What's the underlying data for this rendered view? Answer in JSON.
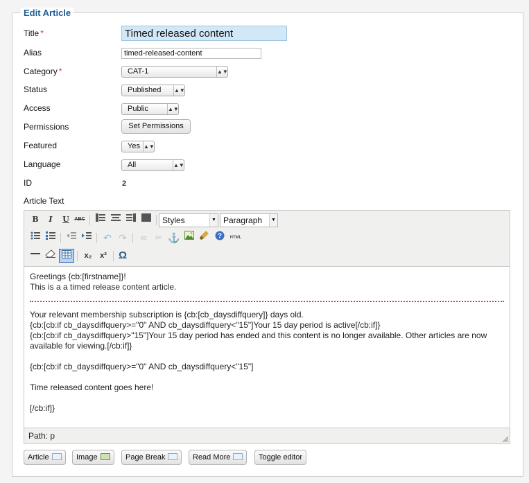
{
  "legend": "Edit Article",
  "fields": {
    "title": {
      "label": "Title",
      "required_mark": "*",
      "value": "Timed released content"
    },
    "alias": {
      "label": "Alias",
      "value": "timed-released-content"
    },
    "category": {
      "label": "Category",
      "required_mark": "*",
      "value": "CAT-1"
    },
    "status": {
      "label": "Status",
      "value": "Published"
    },
    "access": {
      "label": "Access",
      "value": "Public"
    },
    "permissions": {
      "label": "Permissions",
      "button": "Set Permissions"
    },
    "featured": {
      "label": "Featured",
      "value": "Yes"
    },
    "language": {
      "label": "Language",
      "value": "All"
    },
    "id": {
      "label": "ID",
      "value": "2"
    },
    "article_text": {
      "label": "Article Text"
    }
  },
  "toolbar": {
    "row1": {
      "bold": "B",
      "italic": "I",
      "underline": "U",
      "strike": "ABC",
      "styles": "Styles",
      "format": "Paragraph"
    },
    "html_label": "HTML",
    "subscript": "x₂",
    "superscript": "x²",
    "special_char": "Ω"
  },
  "content": {
    "line1": "Greetings {cb:[firstname]}!",
    "line2": "This is a a timed release content article.",
    "line3": "Your relevant membership subscription is {cb:[cb_daysdiffquery]} days old.",
    "line4": "{cb:[cb:if cb_daysdiffquery>=\"0\" AND cb_daysdiffquery<\"15\"]Your 15 day period is active[/cb:if]}",
    "line5": "{cb:[cb:if cb_daysdiffquery>\"15\"]Your 15 day period has ended and this content is no longer available. Other articles are now available for viewing.[/cb:if]}",
    "line6": "{cb:[cb:if cb_daysdiffquery>=\"0\" AND cb_daysdiffquery<\"15\"]",
    "line7": "Time released content goes here!",
    "line8": "[/cb:if]}"
  },
  "path": "Path: p",
  "buttons": {
    "article": "Article",
    "image": "Image",
    "page_break": "Page Break",
    "read_more": "Read More",
    "toggle_editor": "Toggle editor"
  },
  "colors": {
    "legend": "#1f5c97",
    "required": "#d8392b",
    "title_bg": "#d3e8f7",
    "pagebreak": "#d83a3a"
  }
}
